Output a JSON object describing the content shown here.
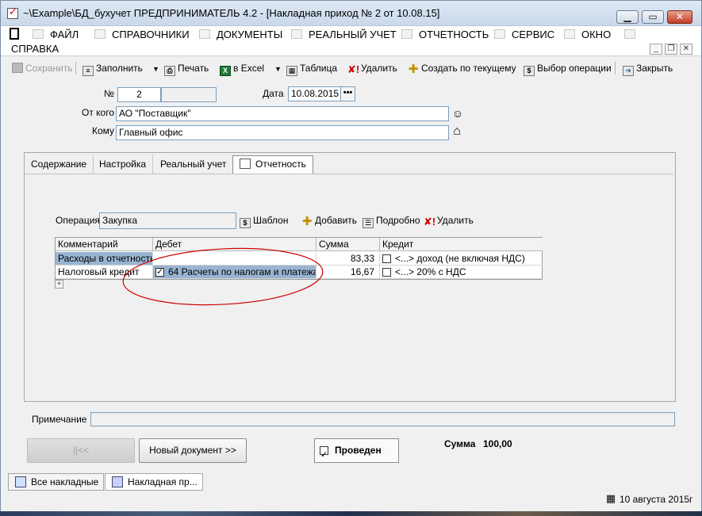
{
  "window": {
    "title": "~\\Example\\БД_бухучет  ПРЕДПРИНИМАТЕЛЬ 4.2 - [Накладная приход № 2 от 10.08.15]",
    "min_label": "▁",
    "max_label": "▭",
    "close_label": "✕"
  },
  "menu": {
    "items": [
      "ФАЙЛ",
      "СПРАВОЧНИКИ",
      "ДОКУМЕНТЫ",
      "РЕАЛЬНЫЙ УЧЕТ",
      "ОТЧЕТНОСТЬ",
      "СЕРВИС",
      "ОКНО",
      "СПРАВКА"
    ],
    "mdi_min": "_",
    "mdi_restore": "❐",
    "mdi_close": "✕"
  },
  "toolbar": {
    "save": "Сохранить",
    "fill": "Заполнить",
    "print": "Печать",
    "excel": "в Excel",
    "table": "Таблица",
    "delete": "Удалить",
    "create_current": "Создать по текущему",
    "choose_operation": "Выбор операции",
    "close": "Закрыть"
  },
  "header": {
    "number_label": "№",
    "number_value": "2",
    "date_label": "Дата",
    "date_value": "10.08.2015",
    "date_button": "•••",
    "from_label": "От кого",
    "from_value": "АО \"Поставщик\"",
    "to_label": "Кому",
    "to_value": "Главный офис"
  },
  "tabs": [
    "Содержание",
    "Настройка",
    "Реальный учет",
    "Отчетность"
  ],
  "operation": {
    "label": "Операция",
    "value": "Закупка",
    "template": "Шаблон",
    "add": "Добавить",
    "details": "Подробно",
    "delete": "Удалить"
  },
  "grid": {
    "columns": [
      "Комментарий",
      "Дебет",
      "Сумма",
      "Кредит"
    ],
    "rows": [
      {
        "comment": "Расходы в отчетность",
        "debit": "",
        "debit_checked": false,
        "sum": "83,33",
        "credit": "<...> доход (не включая НДС)",
        "credit_checked": false
      },
      {
        "comment": "Налоговый кредит",
        "debit": "64 Расчеты по  налогам и платежа",
        "debit_checked": true,
        "sum": "16,67",
        "credit": "<...> 20% с НДС",
        "credit_checked": false
      }
    ],
    "expand": "+"
  },
  "note": {
    "label": "Примечание",
    "value": ""
  },
  "footer": {
    "first_button": "||<<",
    "new_doc_button": "Новый документ >>",
    "posted_label": "Проведен",
    "posted_checked": true,
    "sum_label": "Сумма",
    "sum_value": "100,00"
  },
  "statusbar": {
    "tabs": [
      "Все накладные",
      "Накладная пр..."
    ],
    "date": "10 августа 2015г"
  },
  "colors": {
    "selection": "#99b4d1",
    "annotation": "#cc0000",
    "title_bg": "#dfe9f5"
  }
}
